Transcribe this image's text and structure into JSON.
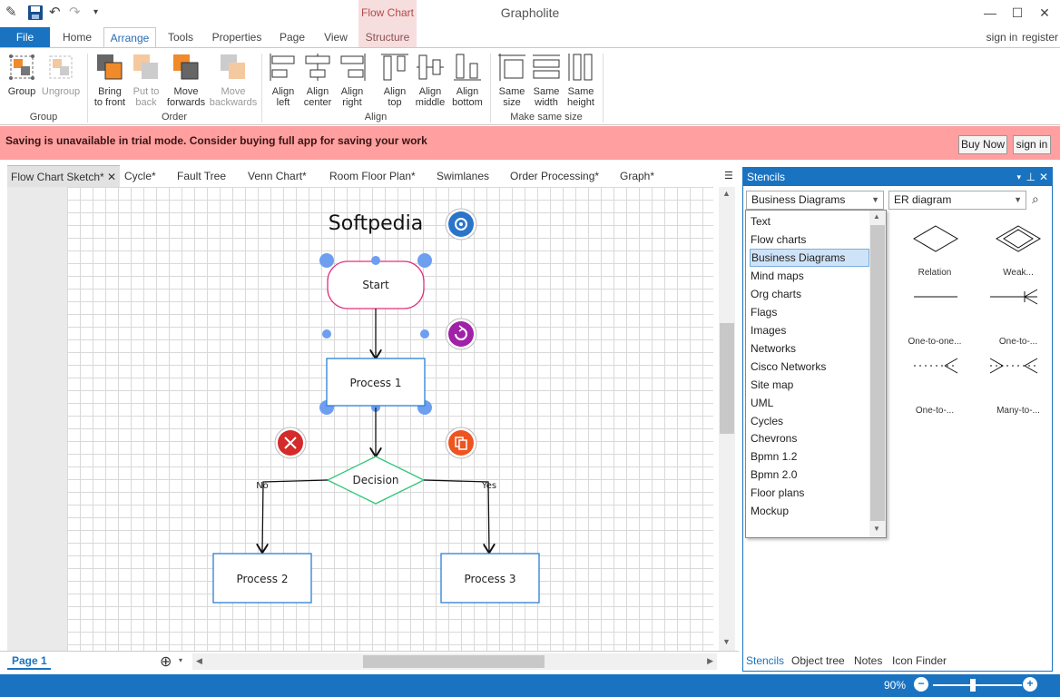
{
  "app_title": "Grapholite",
  "context_tab": "Flow Chart",
  "account": {
    "sign_in": "sign in",
    "register": "register"
  },
  "menu_tabs": [
    "File",
    "Home",
    "Arrange",
    "Tools",
    "Properties",
    "Page",
    "View",
    "Structure"
  ],
  "ribbon": {
    "group": {
      "label": "Group",
      "buttons": [
        "Group",
        "Ungroup"
      ]
    },
    "order": {
      "label": "Order",
      "buttons": [
        [
          "Bring",
          "to front"
        ],
        [
          "Put to",
          "back"
        ],
        [
          "Move",
          "forwards"
        ],
        [
          "Move",
          "backwards"
        ]
      ]
    },
    "align": {
      "label": "Align",
      "buttons": [
        [
          "Align",
          "left"
        ],
        [
          "Align",
          "center"
        ],
        [
          "Align",
          "right"
        ],
        [
          "Align",
          "top"
        ],
        [
          "Align",
          "middle"
        ],
        [
          "Align",
          "bottom"
        ]
      ]
    },
    "same_size": {
      "label": "Make same size",
      "buttons": [
        [
          "Same",
          "size"
        ],
        [
          "Same",
          "width"
        ],
        [
          "Same",
          "height"
        ]
      ]
    }
  },
  "trial_bar": {
    "message": "Saving is unavailable in trial mode. Consider buying full app for saving your work",
    "buy": "Buy Now",
    "sign_in": "sign in"
  },
  "doc_tabs": [
    "Flow Chart Sketch*",
    "Cycle*",
    "Fault Tree",
    "Venn Chart*",
    "Room Floor Plan*",
    "Swimlanes",
    "Order Processing*",
    "Graph*"
  ],
  "diagram": {
    "title": "Softpedia",
    "start": "Start",
    "process1": "Process 1",
    "decision": "Decision",
    "no": "No",
    "yes": "Yes",
    "process2": "Process 2",
    "process3": "Process 3"
  },
  "bottom": {
    "page": "Page 1",
    "zoom": "90%",
    "zoom_level_percent": 90
  },
  "stencils": {
    "title": "Stencils",
    "category_selected": "Business Diagrams",
    "subcategory_selected": "ER diagram",
    "categories": [
      "Text",
      "Flow charts",
      "Business Diagrams",
      "Mind maps",
      "Org charts",
      "Flags",
      "Images",
      "Networks",
      "Cisco Networks",
      "Site map",
      "UML",
      "Cycles",
      "Chevrons",
      "Bpmn 1.2",
      "Bpmn 2.0",
      "Floor plans",
      "Mockup"
    ],
    "shapes": [
      "Relation",
      "Weak...",
      "One-to-one...",
      "One-to-...",
      "One-to-...",
      "Many-to-..."
    ]
  },
  "panel_tabs": [
    "Stencils",
    "Object tree",
    "Notes",
    "Icon Finder"
  ],
  "colors": {
    "accent": "#1a73c1",
    "trial": "#ff9f9f",
    "start_stroke": "#e0307a",
    "process_stroke": "#2a7fd6",
    "decision_stroke": "#2ec47a"
  }
}
